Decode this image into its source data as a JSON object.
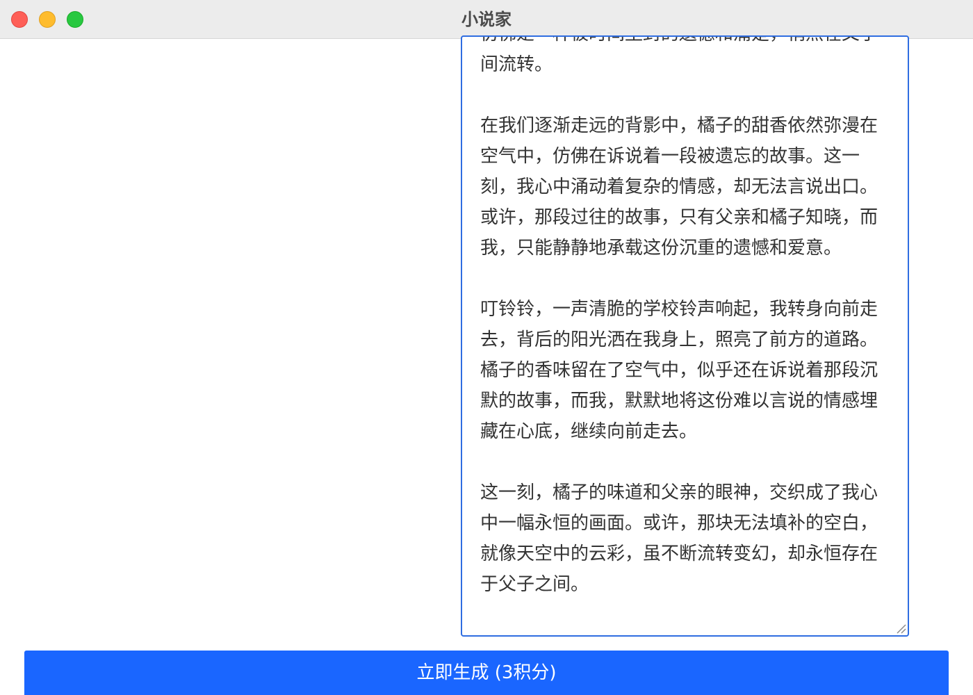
{
  "window": {
    "title": "小说家"
  },
  "editor": {
    "text": "仿佛是一种被时间尘封的遗憾和痛楚，悄然在父子间流转。\n\n在我们逐渐走远的背影中，橘子的甜香依然弥漫在空气中，仿佛在诉说着一段被遗忘的故事。这一刻，我心中涌动着复杂的情感，却无法言说出口。或许，那段过往的故事，只有父亲和橘子知晓，而我，只能静静地承载这份沉重的遗憾和爱意。\n\n叮铃铃，一声清脆的学校铃声响起，我转身向前走去，背后的阳光洒在我身上，照亮了前方的道路。橘子的香味留在了空气中，似乎还在诉说着那段沉默的故事，而我，默默地将这份难以言说的情感埋藏在心底，继续向前走去。\n\n这一刻，橘子的味道和父亲的眼神，交织成了我心中一幅永恒的画面。或许，那块无法填补的空白，就像天空中的云彩，虽不断流转变幻，却永恒存在于父子之间。"
  },
  "actions": {
    "generate_label": "立即生成 (3积分)"
  },
  "colors": {
    "accent": "#1a66ff",
    "focus_border": "#2f6de1",
    "close": "#fe5f57",
    "minimize": "#febc2e",
    "zoom": "#28c840"
  }
}
